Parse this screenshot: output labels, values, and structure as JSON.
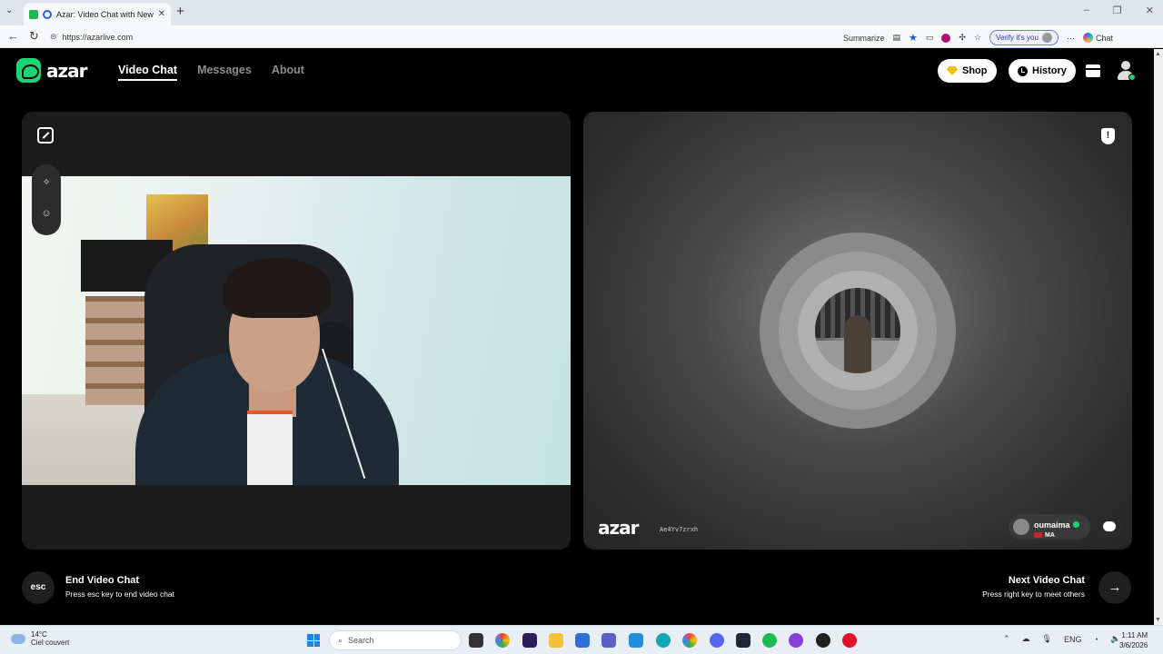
{
  "browser": {
    "tab_title": "Azar: Video Chat with New Pe",
    "url": "https://azarlive.com",
    "summarize_label": "Summarize",
    "verify_label": "Verify it's you",
    "copilot_label": "Chat"
  },
  "header": {
    "logo_text": "azar",
    "nav": [
      "Video Chat",
      "Messages",
      "About"
    ],
    "shop_label": "Shop",
    "history_label": "History"
  },
  "remote": {
    "logo_text": "azar",
    "session_id": "Ae4Yv7zrxh",
    "user_name": "oumaima",
    "user_country": "MA"
  },
  "controls": {
    "esc_key": "esc",
    "end_title": "End Video Chat",
    "end_hint": "Press esc key to end video chat",
    "next_title": "Next Video Chat",
    "next_hint": "Press right key to meet others"
  },
  "taskbar": {
    "temperature": "14°C",
    "weather": "Ciel couvert",
    "search_placeholder": "Search",
    "language": "ENG",
    "time": "1:11 AM",
    "date": "3/6/2026"
  },
  "colors": {
    "brand_green": "#19d673",
    "shop_gem": "#f2c200",
    "panel_bg": "#1c1c1c"
  }
}
